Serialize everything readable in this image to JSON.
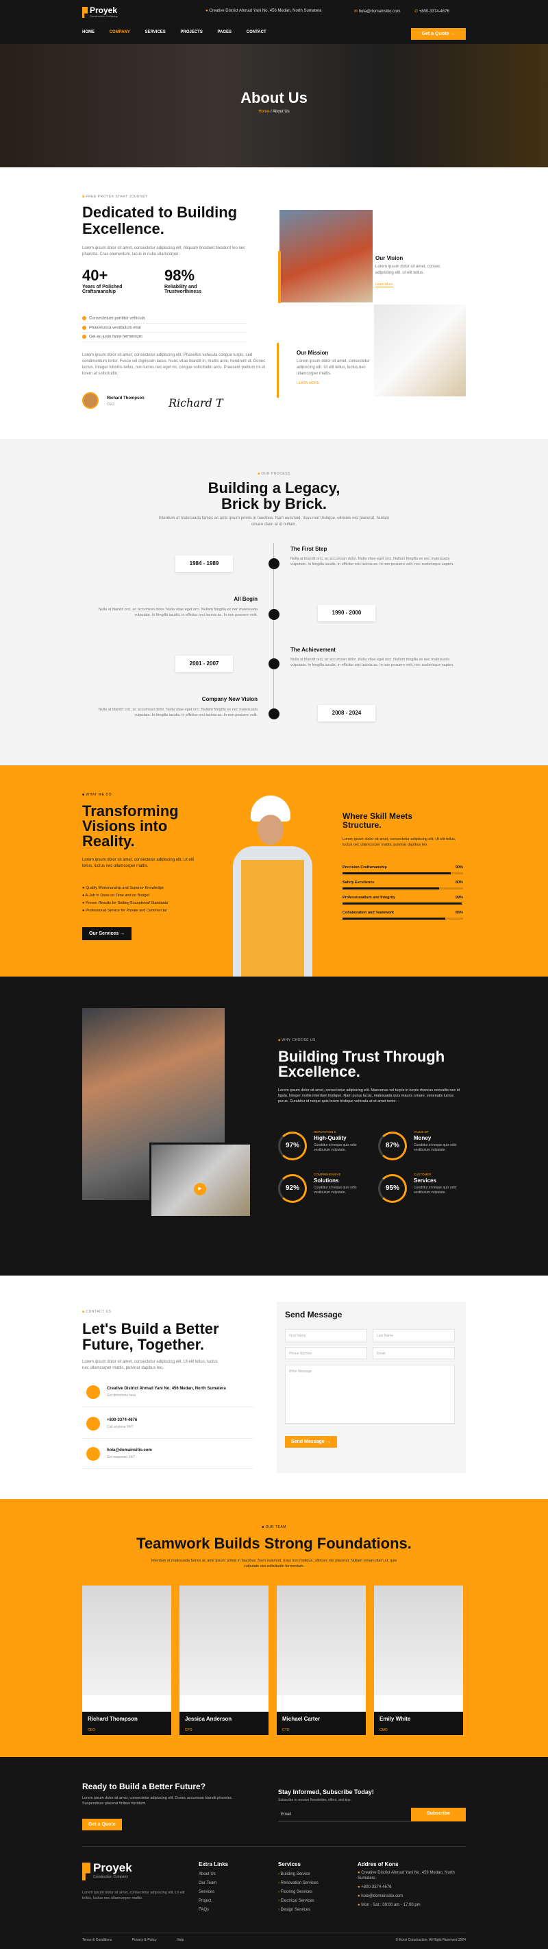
{
  "brand": {
    "name": "Proyek",
    "tagline": "Construction Company"
  },
  "topbar": {
    "address": "Creative District Ahmad Yani No. 456 Medan, North Sumatera",
    "email": "hola@domainsitio.com",
    "phone": "+800-3374-4676",
    "cta": "Get a Quote"
  },
  "nav": {
    "items": [
      "HOME",
      "COMPANY",
      "SERVICES",
      "PROJECTS",
      "PAGES",
      "CONTACT"
    ]
  },
  "hero": {
    "title": "About Us",
    "crumb_home": "Home",
    "crumb_sep": " / ",
    "crumb_current": "About Us"
  },
  "about": {
    "eyebrow": "FREE PROYEK START JOURNEY",
    "title": "Dedicated to Building Excellence.",
    "desc": "Lorem ipsum dolor sit amet, consectetur adipiscing elit. Aliquam tincidunt tincidunt leo nec pharetra. Cras elementum, lacus in nulla ullamcorper.",
    "stat1_val": "40+",
    "stat1_label": "Years of Polished Craftsmanship",
    "stat2_val": "98%",
    "stat2_label": "Reliability and Trustworthiness",
    "checks": [
      "Consectetuer porttitor vehicula",
      "Phasellussa vestibulum etiat",
      "Get eu justo fame fermentum"
    ],
    "para": "Lorem ipsum dolor sit amet, consectetur adipiscing elit. Phasellus vehicula congue turpis, sed condimentum tortor. Fusce vel dignissim lacus. Nunc vitae blandit in, mattis ante, hendrerit ut. Donec lectus. Integer lobortis tellus, non luctus nec eget mi, congue sollicitudin arcu. Praesent pretium mi et lorem at sollicitudin.",
    "person_name": "Richard Thompson",
    "person_role": "CEO",
    "signature": "Richard T",
    "vision_title": "Our Vision",
    "vision_desc": "Lorem ipsum dolor sit amet, consec adipiscing elit. ut elit tellus.",
    "vision_link": "Learn More",
    "mission_title": "Our Mission",
    "mission_desc": "Lorem ipsum dolor sit amet, consectetur adipiscing elit. Ut elit tellus, luctus nec ullamcorper mattis.",
    "mission_link": "LEARN MORE"
  },
  "history": {
    "eyebrow": "OUR PROCESS",
    "title1": "Building a Legacy,",
    "title2": "Brick by Brick.",
    "desc": "Interdum et malesuada fames ac ante ipsum primis in faucibus. Nam euismod, risus non tristique, ultricies nisi placerat. Nullam ornare diam at id nullam.",
    "items": [
      {
        "title": "The First Step",
        "desc": "Nulla at blandit orci, ac accumsan dolor. Nulla vitae eget orci. Nullam fringilla ex nec malesuada vulputate. In fringilla iaculis, in efficitur orci lacinia ac. In non posuere velit, nec scelerisque sapien.",
        "date": "1984 - 1989"
      },
      {
        "title": "All Begin",
        "desc": "Nulla at blandit orci, ac accumsan dolor. Nulla vitae eget orci. Nullam fringilla ex nec malesuada vulputate. In fringilla iaculis, in efficitur orci lacinia ac. In non posuere velit.",
        "date": "1990 - 2000"
      },
      {
        "title": "The Achievement",
        "desc": "Nulla at blandit orci, ac accumsan dolor. Nulla vitae eget orci. Nullam fringilla ex nec malesuada vulputate. In fringilla iaculis, in efficitur orci lacinia ac. In non posuere velit, nec scelerisque sapien.",
        "date": "2001 - 2007"
      },
      {
        "title": "Company New Vision",
        "desc": "Nulla at blandit orci, ac accumsan dolor. Nulla vitae eget orci. Nullam fringilla ex nec malesuada vulputate. In fringilla iaculis, in efficitur orci lacinia ac. In non posuere velit.",
        "date": "2008 - 2024"
      }
    ]
  },
  "what": {
    "eyebrow": "WHAT WE DO",
    "title": "Transforming Visions into Reality.",
    "desc": "Lorem ipsum dolor sit amet, consectetur adipiscing elit. Ut elit tellus, luctus nec ullamcorper mattis.",
    "checks": [
      "Quality Workmanship and Superior Knowledge",
      "A-Job to Done on Time and on Budget",
      "Proven Results for Setting Exceptional Standards",
      "Professional Service for Private and Commercial"
    ],
    "cta": "Our Services",
    "skills_title": "Where Skill Meets Structure.",
    "skills_desc": "Lorem ipsum dolor sit amet, consectetur adipiscing elit. Ut elit tellus, luctus nec ullamcorper mattis, pulvinar dapibus leo.",
    "skills": [
      {
        "label": "Precision Craftsmanship",
        "pct": "90%",
        "value": 0.9
      },
      {
        "label": "Safety Excellence",
        "pct": "80%",
        "value": 0.8
      },
      {
        "label": "Professionalism and Integrity",
        "pct": "99%",
        "value": 0.99
      },
      {
        "label": "Collaboration and Teamwork",
        "pct": "85%",
        "value": 0.85
      }
    ]
  },
  "why": {
    "eyebrow": "WHY CHOOSE US",
    "title": "Building Trust Through Excellence.",
    "desc": "Lorem ipsum dolor sit amet, consectetur adipiscing elit. Maecenas vel turpis in turpis rhoncus convallis nec id ligula. Integer mollis interdum tristique. Nam purus lacus, malesuada quis mauris ornare, venenatis luctus purus. Curabitur id neque quis lorem tristique vehicula at et amet tortor.",
    "stats": [
      {
        "pct": "97%",
        "label": "REPUTATION &",
        "title": "High-Quality",
        "desc": "Curabitur id neque quis odio vestibulum vulputate."
      },
      {
        "pct": "87%",
        "label": "VALUE OF",
        "title": "Money",
        "desc": "Curabitur id neque quis odio vestibulum vulputate."
      },
      {
        "pct": "92%",
        "label": "COMPREHENSIVE",
        "title": "Solutions",
        "desc": "Curabitur id neque quis odio vestibulum vulputate."
      },
      {
        "pct": "95%",
        "label": "CUSTOMER",
        "title": "Services",
        "desc": "Curabitur id neque quis odio vestibulum vulputate."
      }
    ]
  },
  "contact": {
    "eyebrow": "CONTACT US",
    "title": "Let's Build a Better Future, Together.",
    "desc": "Lorem ipsum dolor sit amet, consectetur adipiscing elit. Ut elit tellus, luctus nec ullamcorper mattis, pulvinar dapibus leo.",
    "items": [
      {
        "value": "Creative District Ahmad Yani No. 456 Medan, North Sumatera",
        "sub": "Get directions here"
      },
      {
        "value": "+800-3374-4676",
        "sub": "Call anytime 24/7"
      },
      {
        "value": "hola@domainsitio.com",
        "sub": "Get response 24/7"
      }
    ],
    "form_title": "Send Message",
    "ph_name": "First Name",
    "ph_last": "Last Name",
    "ph_phone": "Phone Number",
    "ph_email": "Email",
    "ph_msg": "Write Message",
    "submit": "Send Message"
  },
  "team": {
    "eyebrow": "OUR TEAM",
    "title": "Teamwork Builds Strong Foundations.",
    "desc": "Interdum et malesuada fames ac ante ipsum primis in faucibus. Nam euismod, risus non tristique, ultricies nisi placerat. Nullam ornare diam at, quis vulputate nisi sollicitudin fermentum.",
    "members": [
      {
        "name": "Richard Thompson",
        "role": "CEO"
      },
      {
        "name": "Jessica Anderson",
        "role": "CFO"
      },
      {
        "name": "Michael Carter",
        "role": "CTO"
      },
      {
        "name": "Emily White",
        "role": "CMO"
      }
    ]
  },
  "cta": {
    "title": "Ready to Build a Better Future?",
    "desc": "Lorem ipsum dolor sit amet, consectetur adipiscing elit. Donec accumsan blandit pharetra. Suspendisse placerat finibus tincidunt.",
    "button": "Get a Quote",
    "sub_title": "Stay Informed, Subscribe Today!",
    "sub_desc": "Subscribe to receive Newsletter, offers, and tips.",
    "sub_ph": "Email",
    "sub_btn": "Subscribe"
  },
  "footer": {
    "desc": "Lorem ipsum dolor sit amet, consectetur adipiscing elit. Ut elit tellus, luctus nec ullamcorper mattis.",
    "col1_title": "Extra Links",
    "col1": [
      "About Us",
      "Our Team",
      "Services",
      "Project",
      "FAQs"
    ],
    "col2_title": "Services",
    "col2": [
      "Building Service",
      "Renovation Services",
      "Flooring Services",
      "Electrical Services",
      "Design Services"
    ],
    "col3_title": "Addres of Kons",
    "addr": "Creative District Ahmad Yani No. 456 Medan, North Sumatera",
    "phone": "+800-3374-4676",
    "email": "hola@domainsitio.com",
    "hours": "Mon - Sat : 09:00 am - 17:00 pm",
    "links": [
      "Terms & Conditions",
      "Privacy & Policy",
      "Help"
    ],
    "copyright": "© Kons Construction. All Right Reserved 2024"
  }
}
